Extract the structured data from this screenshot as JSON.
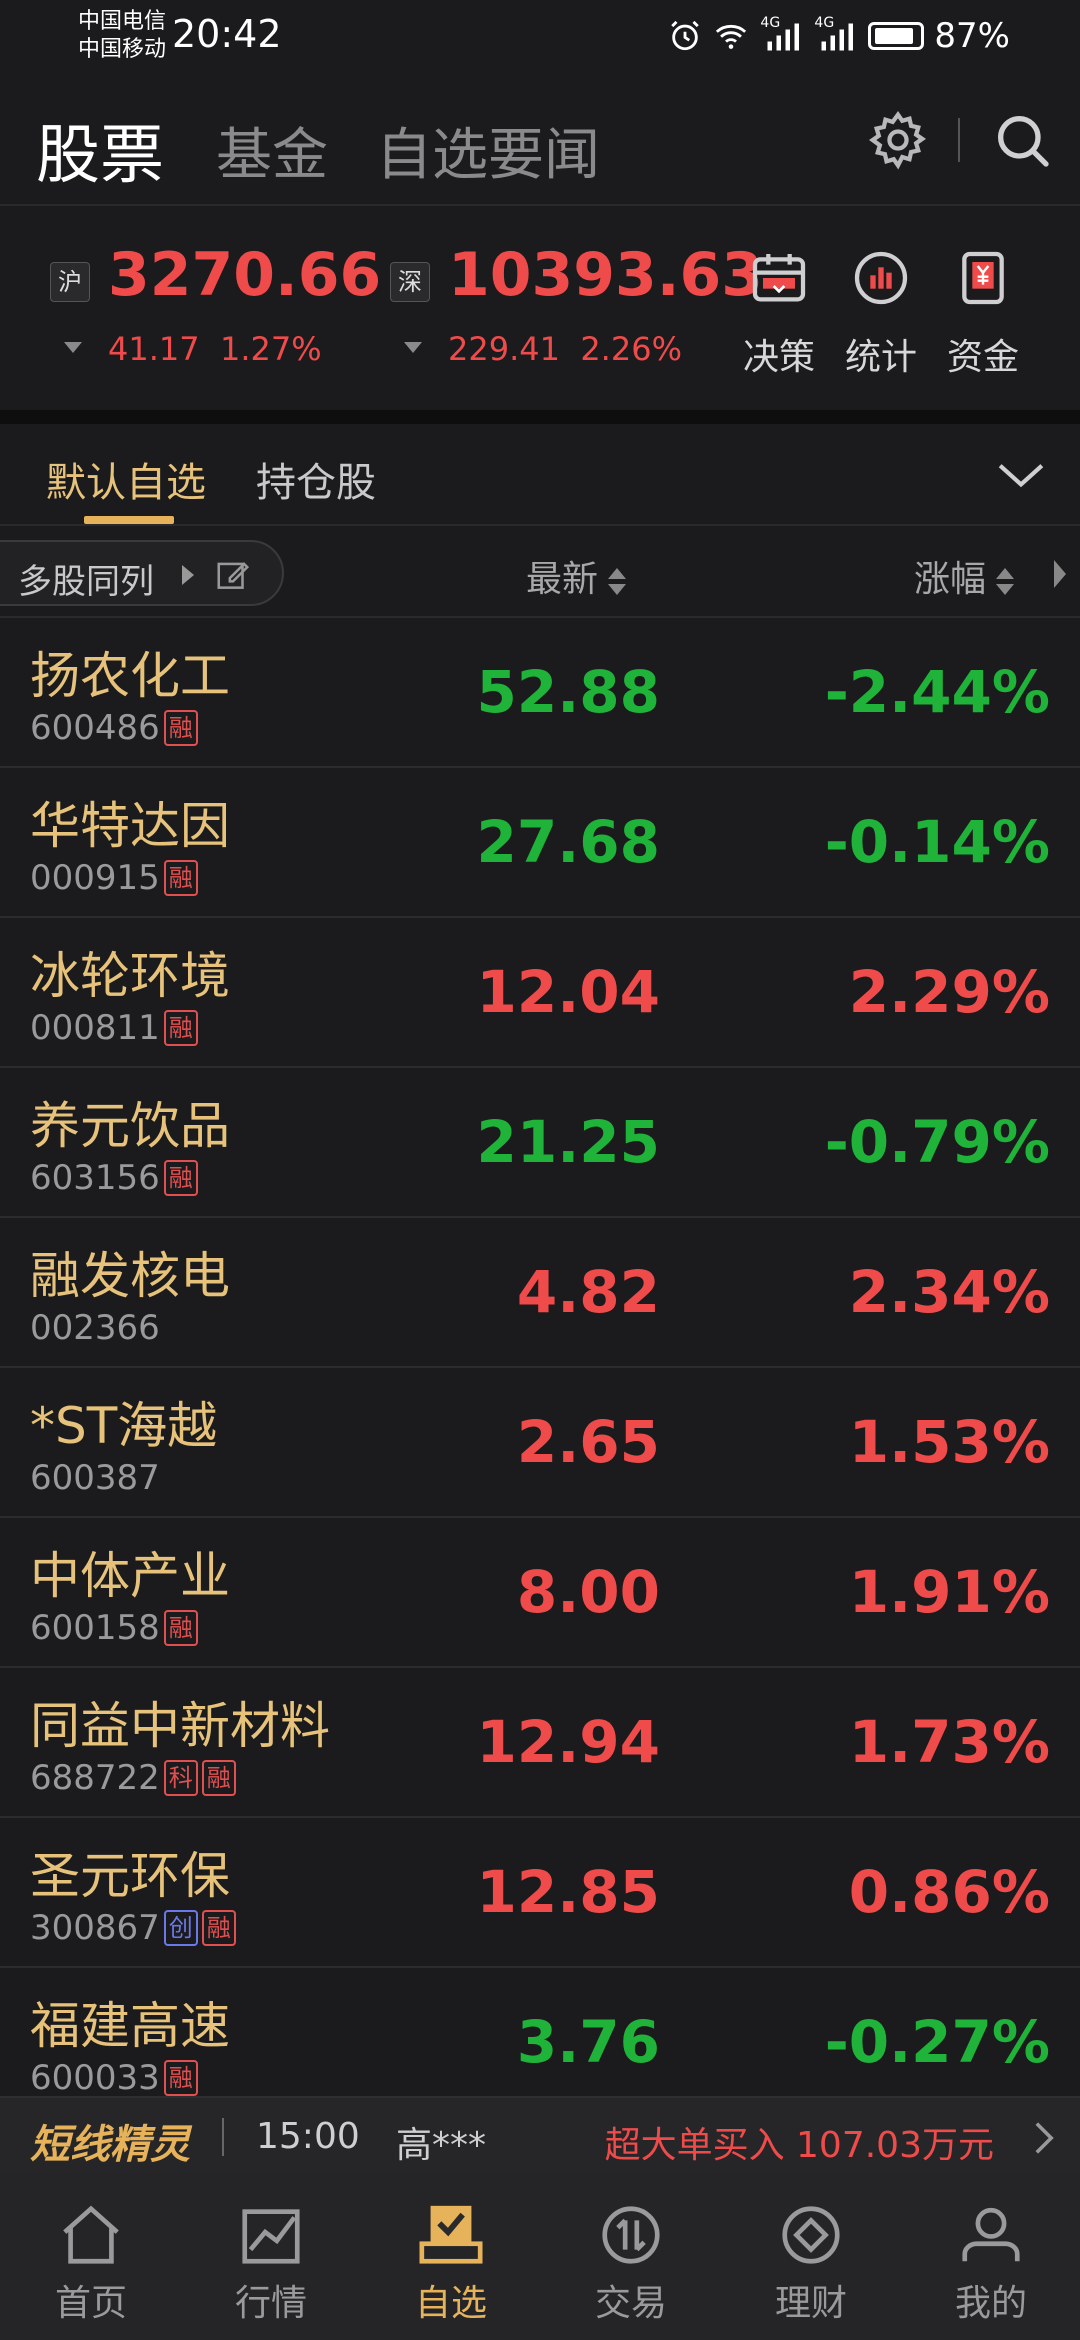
{
  "status_bar": {
    "carrier_1": "中国电信",
    "carrier_2": "中国移动",
    "time": "20:42",
    "network_1": "4G",
    "network_2": "4G",
    "battery": "87%",
    "icons": [
      "alarm-icon",
      "wifi-icon",
      "signal-icon",
      "signal-icon",
      "battery-icon"
    ]
  },
  "top_tabs": [
    "股票",
    "基金",
    "自选要闻"
  ],
  "top_icons": [
    "settings-icon",
    "search-icon"
  ],
  "indices": [
    {
      "tag": "沪",
      "value": "3270.66",
      "change": "41.17",
      "percent": "1.27%"
    },
    {
      "tag": "深",
      "value": "10393.63",
      "change": "229.41",
      "percent": "2.26%"
    }
  ],
  "tools": [
    {
      "label": "决策",
      "icon": "calendar-icon"
    },
    {
      "label": "统计",
      "icon": "bar-chart-icon"
    },
    {
      "label": "资金",
      "icon": "yuan-icon"
    }
  ],
  "watch_tabs": [
    "默认自选",
    "持仓股"
  ],
  "list_header": {
    "multi": "多股同列",
    "latest": "最新",
    "change": "涨幅"
  },
  "stocks": [
    {
      "name": "扬农化工",
      "code": "600486",
      "badges": [
        "融"
      ],
      "price": "52.88",
      "pct": "-2.44%",
      "dir": "dn"
    },
    {
      "name": "华特达因",
      "code": "000915",
      "badges": [
        "融"
      ],
      "price": "27.68",
      "pct": "-0.14%",
      "dir": "dn"
    },
    {
      "name": "冰轮环境",
      "code": "000811",
      "badges": [
        "融"
      ],
      "price": "12.04",
      "pct": "2.29%",
      "dir": "up"
    },
    {
      "name": "养元饮品",
      "code": "603156",
      "badges": [
        "融"
      ],
      "price": "21.25",
      "pct": "-0.79%",
      "dir": "dn"
    },
    {
      "name": "融发核电",
      "code": "002366",
      "badges": [],
      "price": "4.82",
      "pct": "2.34%",
      "dir": "up"
    },
    {
      "name": "*ST海越",
      "code": "600387",
      "badges": [],
      "price": "2.65",
      "pct": "1.53%",
      "dir": "up"
    },
    {
      "name": "中体产业",
      "code": "600158",
      "badges": [
        "融"
      ],
      "price": "8.00",
      "pct": "1.91%",
      "dir": "up"
    },
    {
      "name": "同益中新材料",
      "code": "688722",
      "badges": [
        "科",
        "融"
      ],
      "price": "12.94",
      "pct": "1.73%",
      "dir": "up"
    },
    {
      "name": "圣元环保",
      "code": "300867",
      "badges": [
        "创",
        "融"
      ],
      "price": "12.85",
      "pct": "0.86%",
      "dir": "up"
    },
    {
      "name": "福建高速",
      "code": "600033",
      "badges": [
        "融"
      ],
      "price": "3.76",
      "pct": "-0.27%",
      "dir": "dn"
    }
  ],
  "ticker": {
    "brand": "短线精灵",
    "time": "15:00",
    "user": "高***",
    "message": "超大单买入  107.03万元"
  },
  "bottom_nav": [
    {
      "label": "首页",
      "icon": "home-icon"
    },
    {
      "label": "行情",
      "icon": "market-chart-icon"
    },
    {
      "label": "自选",
      "icon": "watchlist-icon"
    },
    {
      "label": "交易",
      "icon": "trade-icon"
    },
    {
      "label": "理财",
      "icon": "wealth-icon"
    },
    {
      "label": "我的",
      "icon": "profile-icon"
    }
  ],
  "colors": {
    "up": "#ef4b4b",
    "down": "#1fb33a",
    "accent": "#e6b35a",
    "name": "#e6c27a"
  }
}
